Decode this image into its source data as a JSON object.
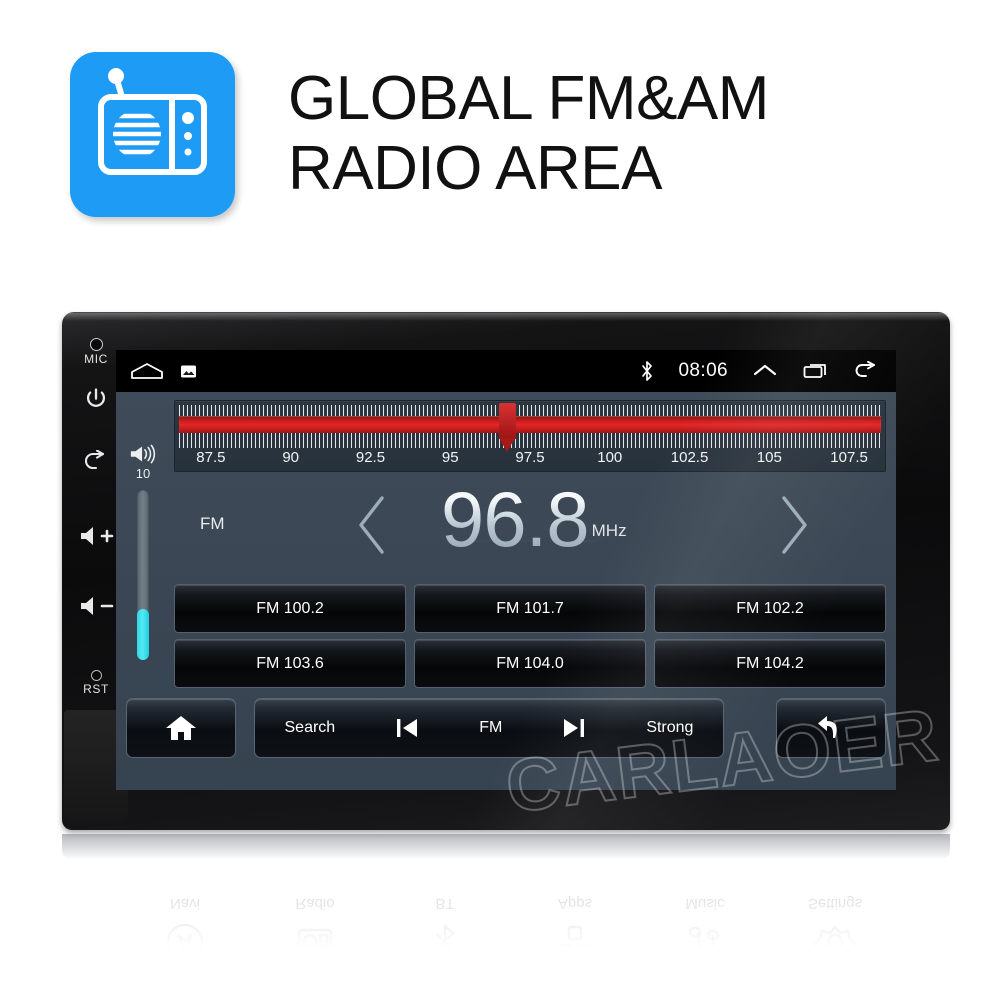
{
  "header": {
    "title_line1": "GLOBAL FM&AM",
    "title_line2": "RADIO AREA",
    "tile_color": "#1e9bf5",
    "tile_icon": "radio-icon"
  },
  "device": {
    "hard_keys": [
      {
        "name": "mic",
        "label": "MIC",
        "icon": "mic-hole-icon"
      },
      {
        "name": "power",
        "label": "",
        "icon": "power-icon"
      },
      {
        "name": "back",
        "label": "",
        "icon": "back-arrow-icon"
      },
      {
        "name": "volume-up",
        "label": "",
        "icon": "volume-up-icon"
      },
      {
        "name": "volume-down",
        "label": "",
        "icon": "volume-down-icon"
      },
      {
        "name": "reset",
        "label": "RST",
        "icon": "reset-hole-icon"
      }
    ]
  },
  "statusbar": {
    "home_icon": "home-icon",
    "screenshot_icon": "screenshot-icon",
    "bluetooth_icon": "bluetooth-icon",
    "clock": "08:06",
    "chevron_up_icon": "chevron-up-icon",
    "recents_icon": "recents-icon",
    "back_icon": "back-arrow-icon"
  },
  "volume": {
    "icon": "volume-icon",
    "level_label": "10",
    "level_percent": 30,
    "fill_color": "#2fd8e8"
  },
  "tuner": {
    "band_color": "#e62626",
    "pointer_color": "#a81818",
    "pointer_frequency": 96.8,
    "scale_min": 86.5,
    "scale_max": 108.5,
    "tick_labels": [
      "87.5",
      "90",
      "92.5",
      "95",
      "97.5",
      "100",
      "102.5",
      "105",
      "107.5"
    ],
    "tick_values": [
      87.5,
      90,
      92.5,
      95,
      97.5,
      100,
      102.5,
      105,
      107.5
    ]
  },
  "display": {
    "band": "FM",
    "frequency": "96.8",
    "unit": "MHz",
    "prev_icon": "chevron-left-icon",
    "next_icon": "chevron-right-icon"
  },
  "presets": [
    {
      "label": "FM 100.2"
    },
    {
      "label": "FM 101.7"
    },
    {
      "label": "FM 102.2"
    },
    {
      "label": "FM 103.6"
    },
    {
      "label": "FM 104.0"
    },
    {
      "label": "FM 104.2"
    }
  ],
  "bottom_bar": {
    "home_icon": "home-filled-icon",
    "search_label": "Search",
    "prev_icon": "skip-previous-icon",
    "band_label": "FM",
    "next_icon": "skip-next-icon",
    "strong_label": "Strong",
    "back_icon": "return-arrow-icon"
  },
  "watermark": {
    "text": "CARLAOER"
  },
  "reflection": {
    "items": [
      {
        "label": "Navi",
        "icon": "navi-icon"
      },
      {
        "label": "Radio",
        "icon": "radio-icon"
      },
      {
        "label": "BT",
        "icon": "bluetooth-icon"
      },
      {
        "label": "Apps",
        "icon": "apps-icon"
      },
      {
        "label": "Music",
        "icon": "music-icon"
      },
      {
        "label": "Settings",
        "icon": "settings-icon"
      }
    ]
  }
}
